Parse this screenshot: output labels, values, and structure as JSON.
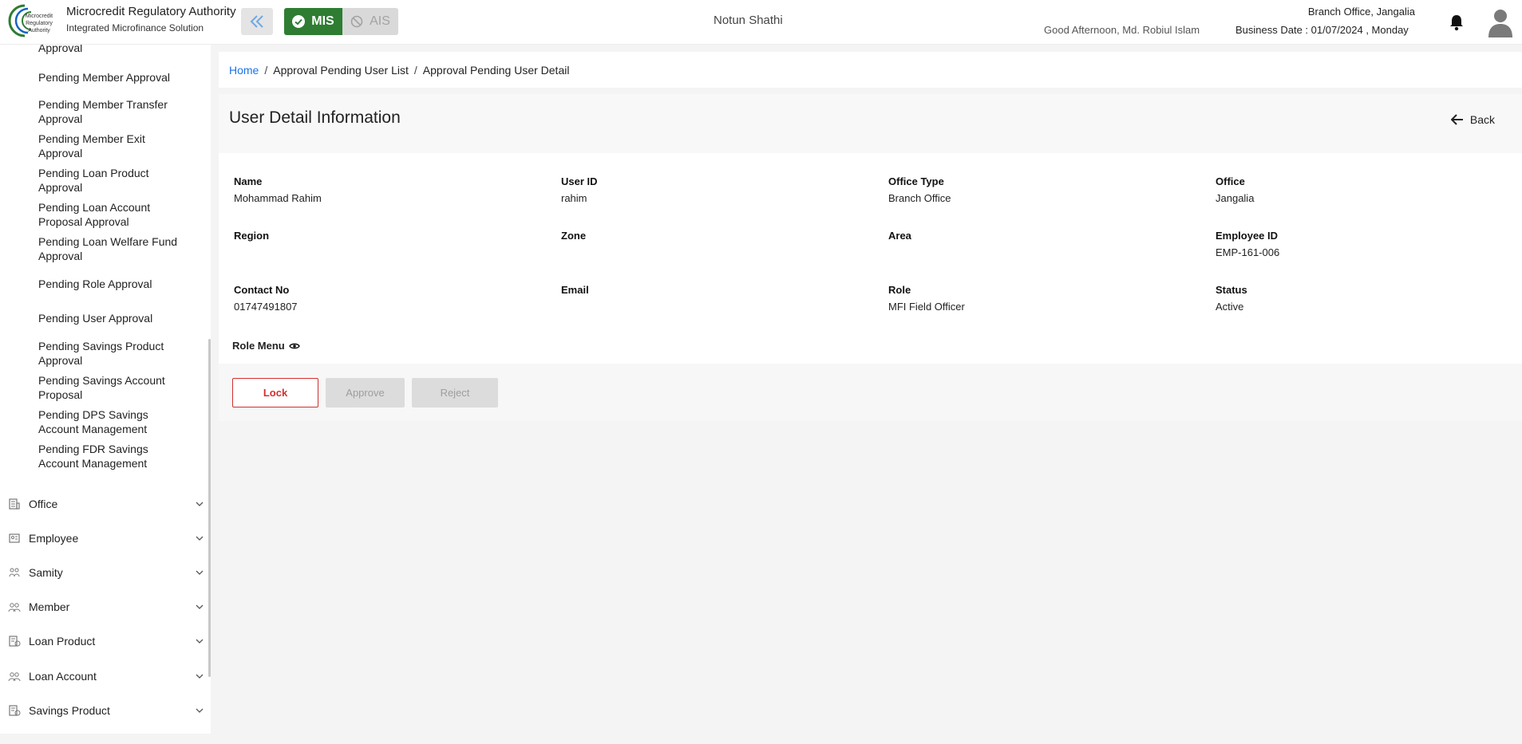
{
  "header": {
    "org_title": "Microcredit Regulatory Authority",
    "org_subtitle": "Integrated Microfinance Solution",
    "logo_text": "Microcredit Regulatory Authority",
    "mis_label": "MIS",
    "ais_label": "AIS",
    "project_name": "Notun Shathi",
    "greeting": "Good Afternoon, Md. Robiul Islam",
    "branch": "Branch Office, Jangalia",
    "business_date": "Business Date : 01/07/2024 , Monday",
    "brand_color": "#2e7d32"
  },
  "sidebar": {
    "partial_item": "Approval",
    "sub_items": [
      "Pending Member Approval",
      "Pending Member Transfer Approval",
      "Pending Member Exit Approval",
      "Pending Loan Product Approval",
      "Pending Loan Account Proposal Approval",
      "Pending Loan Welfare Fund Approval",
      "Pending Role Approval",
      "Pending User Approval",
      "Pending Savings Product Approval",
      "Pending Savings Account Proposal",
      "Pending DPS Savings Account Management",
      "Pending FDR Savings Account Management"
    ],
    "menu": [
      {
        "label": "Office",
        "icon": "office-icon"
      },
      {
        "label": "Employee",
        "icon": "employee-icon"
      },
      {
        "label": "Samity",
        "icon": "samity-icon"
      },
      {
        "label": "Member",
        "icon": "member-icon"
      },
      {
        "label": "Loan Product",
        "icon": "loan-product-icon"
      },
      {
        "label": "Loan Account",
        "icon": "loan-account-icon"
      },
      {
        "label": "Savings Product",
        "icon": "savings-product-icon"
      }
    ]
  },
  "breadcrumb": {
    "home": "Home",
    "sep": "/",
    "list": "Approval Pending User List",
    "current": "Approval Pending User Detail"
  },
  "page": {
    "title": "User Detail Information",
    "back_label": "Back"
  },
  "details": {
    "name": {
      "label": "Name",
      "value": "Mohammad Rahim"
    },
    "user_id": {
      "label": "User ID",
      "value": "rahim"
    },
    "office_type": {
      "label": "Office Type",
      "value": "Branch Office"
    },
    "office": {
      "label": "Office",
      "value": "Jangalia"
    },
    "region": {
      "label": "Region",
      "value": ""
    },
    "zone": {
      "label": "Zone",
      "value": ""
    },
    "area": {
      "label": "Area",
      "value": ""
    },
    "employee_id": {
      "label": "Employee ID",
      "value": "EMP-161-006"
    },
    "contact": {
      "label": "Contact No",
      "value": "01747491807"
    },
    "email": {
      "label": "Email",
      "value": ""
    },
    "role": {
      "label": "Role",
      "value": "MFI Field Officer"
    },
    "status": {
      "label": "Status",
      "value": "Active"
    },
    "role_menu_label": "Role Menu"
  },
  "actions": {
    "lock": "Lock",
    "approve": "Approve",
    "reject": "Reject"
  }
}
